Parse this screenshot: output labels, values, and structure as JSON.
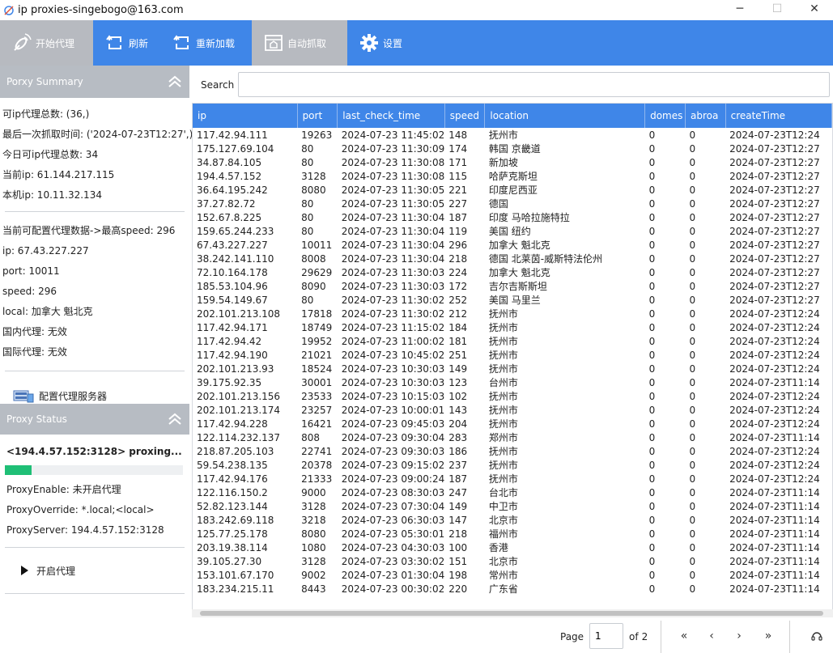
{
  "window": {
    "title": "ip proxies-singebogo@163.com",
    "controls": [
      "─",
      "☐",
      "✕"
    ]
  },
  "toolbar": {
    "start": "开始代理",
    "refresh": "刷新",
    "reload": "重新加载",
    "autofetch": "自动抓取",
    "settings": "设置"
  },
  "summary": {
    "header": "Porxy Summary",
    "lines": [
      "可ip代理总数: (36,)",
      "最后一次抓取时间: ('2024-07-23T12:27',)",
      "今日可ip代理总数: 34",
      "当前ip: 61.144.217.115",
      "本机ip: 10.11.32.134"
    ],
    "config_lines": [
      "当前可配置代理数据->最高speed: 296",
      "ip: 67.43.227.227",
      "port: 10011",
      "speed: 296",
      "local: 加拿大 魁北克",
      "国内代理: 无效",
      "国际代理: 无效"
    ],
    "config_button": "配置代理服务器"
  },
  "status": {
    "header": "Proxy Status",
    "proxying": "<194.4.57.152:3128> proxing...",
    "progress": 0.15,
    "lines": [
      "ProxyEnable: 未开启代理",
      "ProxyOverride: *.local;<local>",
      "ProxyServer: 194.4.57.152:3128"
    ],
    "start_button": "开启代理"
  },
  "search": {
    "label": "Search",
    "value": ""
  },
  "table": {
    "columns": [
      "ip",
      "port",
      "last_check_time",
      "speed",
      "location",
      "domes",
      "abroa",
      "createTime"
    ],
    "rows": [
      [
        "117.42.94.111",
        "19263",
        "2024-07-23 11:45:02",
        "148",
        "抚州市",
        "0",
        "0",
        "2024-07-23T12:24"
      ],
      [
        "175.127.69.104",
        "80",
        "2024-07-23 11:30:09",
        "174",
        "韩国 京畿道",
        "0",
        "0",
        "2024-07-23T12:27"
      ],
      [
        "34.87.84.105",
        "80",
        "2024-07-23 11:30:08",
        "171",
        "新加坡",
        "0",
        "0",
        "2024-07-23T12:27"
      ],
      [
        "194.4.57.152",
        "3128",
        "2024-07-23 11:30:08",
        "115",
        "哈萨克斯坦",
        "0",
        "0",
        "2024-07-23T12:27"
      ],
      [
        "36.64.195.242",
        "8080",
        "2024-07-23 11:30:05",
        "221",
        "印度尼西亚",
        "0",
        "0",
        "2024-07-23T12:27"
      ],
      [
        "37.27.82.72",
        "80",
        "2024-07-23 11:30:05",
        "227",
        "德国",
        "0",
        "0",
        "2024-07-23T12:27"
      ],
      [
        "152.67.8.225",
        "80",
        "2024-07-23 11:30:04",
        "187",
        "印度 马哈拉施特拉",
        "0",
        "0",
        "2024-07-23T12:27"
      ],
      [
        "159.65.244.233",
        "80",
        "2024-07-23 11:30:04",
        "119",
        "美国 纽约",
        "0",
        "0",
        "2024-07-23T12:27"
      ],
      [
        "67.43.227.227",
        "10011",
        "2024-07-23 11:30:04",
        "296",
        "加拿大 魁北克",
        "0",
        "0",
        "2024-07-23T12:27"
      ],
      [
        "38.242.141.110",
        "8008",
        "2024-07-23 11:30:04",
        "218",
        "德国 北莱茵-威斯特法伦州",
        "0",
        "0",
        "2024-07-23T12:27"
      ],
      [
        "72.10.164.178",
        "29629",
        "2024-07-23 11:30:03",
        "224",
        "加拿大 魁北克",
        "0",
        "0",
        "2024-07-23T12:27"
      ],
      [
        "185.53.104.96",
        "8090",
        "2024-07-23 11:30:03",
        "172",
        "吉尔吉斯斯坦",
        "0",
        "0",
        "2024-07-23T12:27"
      ],
      [
        "159.54.149.67",
        "80",
        "2024-07-23 11:30:02",
        "252",
        "美国 马里兰",
        "0",
        "0",
        "2024-07-23T12:27"
      ],
      [
        "202.101.213.108",
        "17818",
        "2024-07-23 11:30:02",
        "212",
        "抚州市",
        "0",
        "0",
        "2024-07-23T12:24"
      ],
      [
        "117.42.94.171",
        "18749",
        "2024-07-23 11:15:02",
        "184",
        "抚州市",
        "0",
        "0",
        "2024-07-23T12:24"
      ],
      [
        "117.42.94.42",
        "19952",
        "2024-07-23 11:00:02",
        "181",
        "抚州市",
        "0",
        "0",
        "2024-07-23T12:24"
      ],
      [
        "117.42.94.190",
        "21021",
        "2024-07-23 10:45:02",
        "251",
        "抚州市",
        "0",
        "0",
        "2024-07-23T12:24"
      ],
      [
        "202.101.213.93",
        "18524",
        "2024-07-23 10:30:03",
        "149",
        "抚州市",
        "0",
        "0",
        "2024-07-23T12:24"
      ],
      [
        "39.175.92.35",
        "30001",
        "2024-07-23 10:30:03",
        "123",
        "台州市",
        "0",
        "0",
        "2024-07-23T11:14"
      ],
      [
        "202.101.213.156",
        "23533",
        "2024-07-23 10:15:03",
        "102",
        "抚州市",
        "0",
        "0",
        "2024-07-23T12:24"
      ],
      [
        "202.101.213.174",
        "23257",
        "2024-07-23 10:00:01",
        "143",
        "抚州市",
        "0",
        "0",
        "2024-07-23T12:24"
      ],
      [
        "117.42.94.228",
        "16421",
        "2024-07-23 09:45:03",
        "204",
        "抚州市",
        "0",
        "0",
        "2024-07-23T12:24"
      ],
      [
        "122.114.232.137",
        "808",
        "2024-07-23 09:30:04",
        "283",
        "郑州市",
        "0",
        "0",
        "2024-07-23T11:14"
      ],
      [
        "218.87.205.103",
        "22741",
        "2024-07-23 09:30:03",
        "186",
        "抚州市",
        "0",
        "0",
        "2024-07-23T12:24"
      ],
      [
        "59.54.238.135",
        "20378",
        "2024-07-23 09:15:02",
        "237",
        "抚州市",
        "0",
        "0",
        "2024-07-23T12:24"
      ],
      [
        "117.42.94.176",
        "21333",
        "2024-07-23 09:00:24",
        "187",
        "抚州市",
        "0",
        "0",
        "2024-07-23T12:24"
      ],
      [
        "122.116.150.2",
        "9000",
        "2024-07-23 08:30:03",
        "247",
        "台北市",
        "0",
        "0",
        "2024-07-23T11:14"
      ],
      [
        "52.82.123.144",
        "3128",
        "2024-07-23 07:30:04",
        "149",
        "中卫市",
        "0",
        "0",
        "2024-07-23T11:14"
      ],
      [
        "183.242.69.118",
        "3218",
        "2024-07-23 06:30:03",
        "147",
        "北京市",
        "0",
        "0",
        "2024-07-23T11:14"
      ],
      [
        "125.77.25.178",
        "8080",
        "2024-07-23 05:30:01",
        "218",
        "福州市",
        "0",
        "0",
        "2024-07-23T11:14"
      ],
      [
        "203.19.38.114",
        "1080",
        "2024-07-23 04:30:03",
        "100",
        "香港",
        "0",
        "0",
        "2024-07-23T11:14"
      ],
      [
        "39.105.27.30",
        "3128",
        "2024-07-23 03:30:02",
        "151",
        "北京市",
        "0",
        "0",
        "2024-07-23T11:14"
      ],
      [
        "153.101.67.170",
        "9002",
        "2024-07-23 01:30:04",
        "198",
        "常州市",
        "0",
        "0",
        "2024-07-23T11:14"
      ],
      [
        "183.234.215.11",
        "8443",
        "2024-07-23 00:30:02",
        "220",
        "广东省",
        "0",
        "0",
        "2024-07-23T11:14"
      ]
    ]
  },
  "pager": {
    "page_label": "Page",
    "page_value": "1",
    "of_label": "of",
    "of_total": "2",
    "first": "«",
    "prev": "‹",
    "next": "›",
    "last": "»"
  },
  "colors": {
    "toolbar": "#3f86e8",
    "toolbar_active": "#b7bac0",
    "section_header": "#b7bcc3",
    "progress": "#1fbf76"
  }
}
